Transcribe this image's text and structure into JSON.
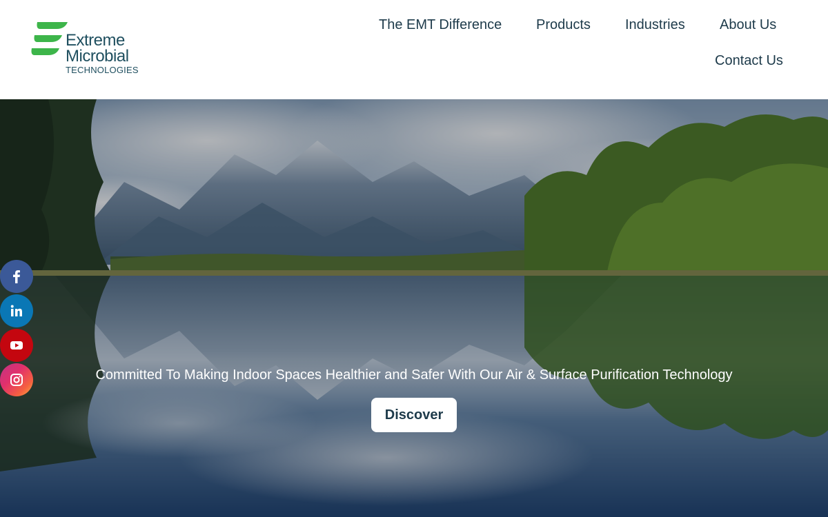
{
  "logo": {
    "line1": "Extreme",
    "line2": "Microbial",
    "line3": "TECHNOLOGIES",
    "brand_green": "#3db54a",
    "text_color": "#1f4f5f"
  },
  "nav": {
    "items": [
      {
        "label": "The EMT Difference"
      },
      {
        "label": "Products"
      },
      {
        "label": "Industries"
      },
      {
        "label": "About Us"
      },
      {
        "label": "Contact Us"
      }
    ]
  },
  "hero": {
    "tagline": "Committed To Making Indoor Spaces Healthier and Safer With Our Air & Surface Purification Technology",
    "button_label": "Discover"
  },
  "social": [
    {
      "icon": "facebook-icon",
      "color": "#3b5998"
    },
    {
      "icon": "linkedin-icon",
      "color": "#0a77b5"
    },
    {
      "icon": "youtube-icon",
      "color": "#c4060f"
    },
    {
      "icon": "instagram-icon",
      "color": "#e1306c"
    }
  ]
}
